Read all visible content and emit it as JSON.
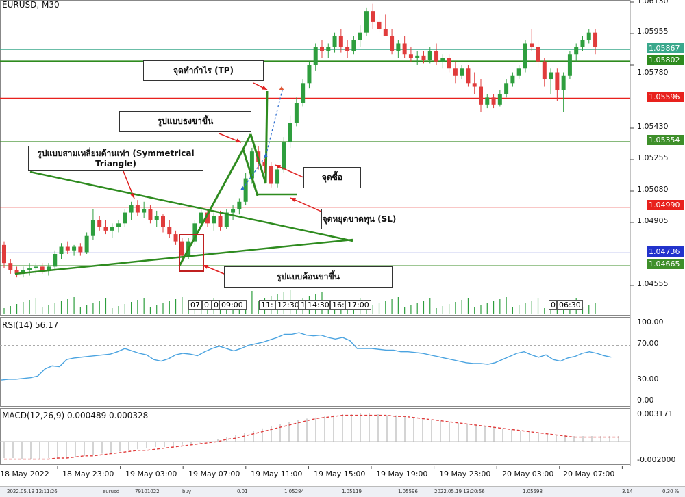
{
  "header": {
    "symbol": "EURUSD, M30"
  },
  "price_axis": {
    "ticks": [
      "1.06130",
      "1.05955",
      "1.05780",
      "1.05430",
      "1.05255",
      "1.05080",
      "1.04905",
      "1.04555"
    ],
    "labels": [
      {
        "text": "1.05867",
        "color": "#3aa88c"
      },
      {
        "text": "1.05802",
        "color": "#2e8b1f"
      },
      {
        "text": "1.05596",
        "color": "#e8211d"
      },
      {
        "text": "1.05354",
        "color": "#3e8f2a"
      },
      {
        "text": "1.04990",
        "color": "#e8211d"
      },
      {
        "text": "1.04736",
        "color": "#2233cc"
      },
      {
        "text": "1.04665",
        "color": "#3e8f2a"
      }
    ]
  },
  "annotations": {
    "tp": "จุดทำกำไร (TP)",
    "flag": "รูปแบบธงขาขึ้น",
    "triangle": "รูปแบบสามเหลี่ยมด้านเท่า (Symmetrical Triangle)",
    "buy": "จุดซื้อ",
    "sl": "จุดหยุดขาดทุน (SL)",
    "hammer": "รูปแบบค้อนขาขึ้น"
  },
  "time_marks": [
    "07:",
    "0",
    "0",
    "09:00",
    "11:",
    "12:30",
    "1",
    "14:30",
    "16:",
    "17:00",
    "0",
    "06:30"
  ],
  "rsi": {
    "title": "RSI(14) 56.17",
    "ticks": [
      "100.00",
      "70.00",
      "30.00",
      "0.00"
    ]
  },
  "macd": {
    "title": "MACD(12,26,9) 0.000489 0.000328",
    "ticks": [
      "0.003171",
      "-0.002000"
    ]
  },
  "time_axis": [
    "18 May 2022",
    "18 May 23:00",
    "19 May 03:00",
    "19 May 07:00",
    "19 May 11:00",
    "19 May 15:00",
    "19 May 19:00",
    "19 May 23:00",
    "20 May 03:00",
    "20 May 07:00"
  ],
  "status": [
    "2022.05.19 12:11:26",
    "eurusd",
    "79101022",
    "buy",
    "0.01",
    "1.05284",
    "1.05119",
    "1.05596",
    "2022.05.19 13:20:56",
    "1.05598",
    "3.14",
    "0.30 %"
  ],
  "colors": {
    "bull": "#2e9e3e",
    "bear": "#e03c3c",
    "line_green": "#2e8b1f",
    "rsi": "#4aa3e0",
    "signal": "#e03c3c"
  },
  "chart_data": {
    "type": "candlestick",
    "symbol": "EURUSD",
    "timeframe": "M30",
    "ohlc": [
      [
        1.0478,
        1.048,
        1.0465,
        1.0468
      ],
      [
        1.0468,
        1.047,
        1.0462,
        1.0464
      ],
      [
        1.0464,
        1.0466,
        1.046,
        1.0462
      ],
      [
        1.0462,
        1.0466,
        1.046,
        1.0464
      ],
      [
        1.0464,
        1.0468,
        1.0461,
        1.0465
      ],
      [
        1.0465,
        1.0468,
        1.0462,
        1.0466
      ],
      [
        1.0466,
        1.0468,
        1.0462,
        1.0464
      ],
      [
        1.0464,
        1.0468,
        1.0461,
        1.0466
      ],
      [
        1.0466,
        1.0475,
        1.0464,
        1.0473
      ],
      [
        1.0473,
        1.0479,
        1.047,
        1.0477
      ],
      [
        1.0477,
        1.048,
        1.0473,
        1.0475
      ],
      [
        1.0475,
        1.0478,
        1.0472,
        1.0477
      ],
      [
        1.0477,
        1.0479,
        1.0472,
        1.0474
      ],
      [
        1.0474,
        1.0485,
        1.0473,
        1.0483
      ],
      [
        1.0483,
        1.0498,
        1.0481,
        1.0492
      ],
      [
        1.0492,
        1.0494,
        1.0486,
        1.0488
      ],
      [
        1.0488,
        1.0492,
        1.0484,
        1.0486
      ],
      [
        1.0486,
        1.049,
        1.0482,
        1.0488
      ],
      [
        1.0488,
        1.0492,
        1.0485,
        1.049
      ],
      [
        1.049,
        1.0498,
        1.0488,
        1.0496
      ],
      [
        1.0496,
        1.0502,
        1.0492,
        1.05
      ],
      [
        1.05,
        1.0503,
        1.0494,
        1.0496
      ],
      [
        1.0496,
        1.0502,
        1.0493,
        1.0498
      ],
      [
        1.0498,
        1.05,
        1.049,
        1.0492
      ],
      [
        1.0492,
        1.0497,
        1.0488,
        1.0494
      ],
      [
        1.0494,
        1.0495,
        1.0485,
        1.0488
      ],
      [
        1.0488,
        1.0492,
        1.0482,
        1.0484
      ],
      [
        1.0484,
        1.0486,
        1.0478,
        1.048
      ],
      [
        1.048,
        1.0482,
        1.0468,
        1.0472
      ],
      [
        1.0472,
        1.0482,
        1.047,
        1.048
      ],
      [
        1.048,
        1.0492,
        1.0478,
        1.049
      ],
      [
        1.049,
        1.0498,
        1.0488,
        1.0496
      ],
      [
        1.0496,
        1.0498,
        1.0488,
        1.049
      ],
      [
        1.049,
        1.0496,
        1.0486,
        1.0494
      ],
      [
        1.0494,
        1.0497,
        1.0486,
        1.0488
      ],
      [
        1.0488,
        1.0498,
        1.0487,
        1.0496
      ],
      [
        1.0496,
        1.05,
        1.0492,
        1.0498
      ],
      [
        1.0498,
        1.0504,
        1.0495,
        1.0502
      ],
      [
        1.0502,
        1.0518,
        1.05,
        1.0515
      ],
      [
        1.0515,
        1.0532,
        1.0512,
        1.053
      ],
      [
        1.053,
        1.0533,
        1.052,
        1.0524
      ],
      [
        1.0524,
        1.0526,
        1.0518,
        1.0522
      ],
      [
        1.0522,
        1.0524,
        1.051,
        1.0512
      ],
      [
        1.0512,
        1.0522,
        1.051,
        1.052
      ],
      [
        1.052,
        1.0538,
        1.0518,
        1.0535
      ],
      [
        1.0535,
        1.055,
        1.0532,
        1.0546
      ],
      [
        1.0546,
        1.056,
        1.0544,
        1.0557
      ],
      [
        1.0557,
        1.057,
        1.0555,
        1.0568
      ],
      [
        1.0568,
        1.058,
        1.0565,
        1.0578
      ],
      [
        1.0578,
        1.059,
        1.0575,
        1.0588
      ],
      [
        1.0588,
        1.0592,
        1.0582,
        1.0586
      ],
      [
        1.0586,
        1.059,
        1.0582,
        1.0588
      ],
      [
        1.0588,
        1.0596,
        1.0585,
        1.0594
      ],
      [
        1.0594,
        1.0598,
        1.0585,
        1.0588
      ],
      [
        1.0588,
        1.0592,
        1.0582,
        1.0586
      ],
      [
        1.0586,
        1.0594,
        1.0584,
        1.0592
      ],
      [
        1.0592,
        1.06,
        1.0588,
        1.0596
      ],
      [
        1.0596,
        1.061,
        1.0594,
        1.0608
      ],
      [
        1.0608,
        1.0612,
        1.0598,
        1.0602
      ],
      [
        1.0602,
        1.0606,
        1.0596,
        1.0598
      ],
      [
        1.0598,
        1.0606,
        1.0594,
        1.0594
      ],
      [
        1.0594,
        1.0598,
        1.0584,
        1.0586
      ],
      [
        1.0586,
        1.0592,
        1.0582,
        1.059
      ],
      [
        1.059,
        1.0594,
        1.0582,
        1.0584
      ],
      [
        1.0584,
        1.0588,
        1.058,
        1.0582
      ],
      [
        1.0582,
        1.0586,
        1.0578,
        1.0583
      ],
      [
        1.0583,
        1.0586,
        1.0579,
        1.0581
      ],
      [
        1.0581,
        1.0588,
        1.0579,
        1.0586
      ],
      [
        1.0586,
        1.059,
        1.0578,
        1.058
      ],
      [
        1.058,
        1.0584,
        1.0576,
        1.0582
      ],
      [
        1.0582,
        1.0584,
        1.0574,
        1.0576
      ],
      [
        1.0576,
        1.058,
        1.0568,
        1.0572
      ],
      [
        1.0572,
        1.0578,
        1.057,
        1.0576
      ],
      [
        1.0576,
        1.0578,
        1.0566,
        1.0568
      ],
      [
        1.0568,
        1.0574,
        1.0562,
        1.0566
      ],
      [
        1.0566,
        1.057,
        1.0552,
        1.0556
      ],
      [
        1.0556,
        1.0562,
        1.0554,
        1.056
      ],
      [
        1.056,
        1.0562,
        1.0554,
        1.0556
      ],
      [
        1.0556,
        1.0564,
        1.0555,
        1.0562
      ],
      [
        1.0562,
        1.057,
        1.056,
        1.0568
      ],
      [
        1.0568,
        1.0574,
        1.0566,
        1.0572
      ],
      [
        1.0572,
        1.0578,
        1.057,
        1.0576
      ],
      [
        1.0576,
        1.0592,
        1.0574,
        1.059
      ],
      [
        1.059,
        1.0598,
        1.0586,
        1.0588
      ],
      [
        1.0588,
        1.0592,
        1.0576,
        1.058
      ],
      [
        1.058,
        1.0582,
        1.0566,
        1.057
      ],
      [
        1.057,
        1.0576,
        1.0562,
        1.0574
      ],
      [
        1.0574,
        1.0576,
        1.0558,
        1.0564
      ],
      [
        1.0564,
        1.0574,
        1.0552,
        1.0572
      ],
      [
        1.0572,
        1.0586,
        1.057,
        1.0584
      ],
      [
        1.0584,
        1.059,
        1.058,
        1.0588
      ],
      [
        1.0588,
        1.0594,
        1.0586,
        1.0592
      ],
      [
        1.0592,
        1.0598,
        1.059,
        1.0596
      ],
      [
        1.0596,
        1.0598,
        1.0584,
        1.0588
      ]
    ],
    "rsi_values": [
      26,
      27,
      27,
      28,
      29,
      31,
      40,
      44,
      43,
      52,
      54,
      55,
      56,
      57,
      58,
      59,
      62,
      66,
      63,
      60,
      58,
      52,
      50,
      53,
      58,
      60,
      59,
      57,
      62,
      66,
      69,
      66,
      63,
      66,
      70,
      72,
      74,
      77,
      80,
      84,
      84,
      86,
      83,
      82,
      83,
      80,
      78,
      80,
      76,
      66,
      66,
      66,
      65,
      64,
      64,
      62,
      62,
      61,
      60,
      58,
      56,
      54,
      52,
      50,
      48,
      47,
      47,
      46,
      48,
      52,
      56,
      60,
      62,
      58,
      55,
      58,
      52,
      50,
      54,
      56,
      60,
      62,
      60,
      57,
      55
    ],
    "macd_hist": [
      -0.0015,
      -0.0015,
      -0.0016,
      -0.0016,
      -0.0016,
      -0.0015,
      -0.0015,
      -0.0014,
      -0.0014,
      -0.0013,
      -0.0012,
      -0.0011,
      -0.001,
      -0.0009,
      -0.0008,
      -0.0007,
      -0.0006,
      -0.0005,
      -0.0005,
      -0.0004,
      -0.0003,
      -0.0002,
      -0.0001,
      0.0,
      0.0002,
      0.0004,
      0.0006,
      0.0008,
      0.001,
      0.0012,
      0.0014,
      0.0016,
      0.0018,
      0.002,
      0.0021,
      0.0022,
      0.0023,
      0.0024,
      0.0025,
      0.0025,
      0.0026,
      0.0026,
      0.0025,
      0.0024,
      0.0024,
      0.0023,
      0.0022,
      0.0021,
      0.002,
      0.0019,
      0.0018,
      0.0017,
      0.0016,
      0.0015,
      0.0014,
      0.0013,
      0.0012,
      0.0011,
      0.001,
      0.0009,
      0.0008,
      0.0007,
      0.0006,
      0.0006,
      0.0005,
      0.0005,
      0.0005,
      0.0005,
      0.0005,
      0.0005
    ],
    "macd_signal": [
      -0.0016,
      -0.0016,
      -0.0016,
      -0.0016,
      -0.0016,
      -0.0016,
      -0.0015,
      -0.0015,
      -0.0014,
      -0.0013,
      -0.0013,
      -0.0012,
      -0.0011,
      -0.001,
      -0.0009,
      -0.0008,
      -0.0008,
      -0.0007,
      -0.0006,
      -0.0005,
      -0.0004,
      -0.0003,
      -0.0002,
      -0.0001,
      0.0,
      0.0002,
      0.0003,
      0.0005,
      0.0007,
      0.0009,
      0.0011,
      0.0013,
      0.0015,
      0.0017,
      0.0019,
      0.0021,
      0.0022,
      0.0023,
      0.0024,
      0.0024,
      0.0024,
      0.0024,
      0.0024,
      0.0024,
      0.0023,
      0.0023,
      0.0022,
      0.0021,
      0.002,
      0.0019,
      0.0018,
      0.0017,
      0.0016,
      0.0015,
      0.0014,
      0.0013,
      0.0012,
      0.0011,
      0.001,
      0.0009,
      0.0008,
      0.0007,
      0.0006,
      0.0005,
      0.0004,
      0.0004,
      0.0004,
      0.0004,
      0.0004,
      0.0004
    ],
    "levels": [
      1.05867,
      1.05802,
      1.05596,
      1.05354,
      1.0499,
      1.04736,
      1.04665
    ],
    "y_range": [
      1.0447,
      1.0614
    ]
  }
}
